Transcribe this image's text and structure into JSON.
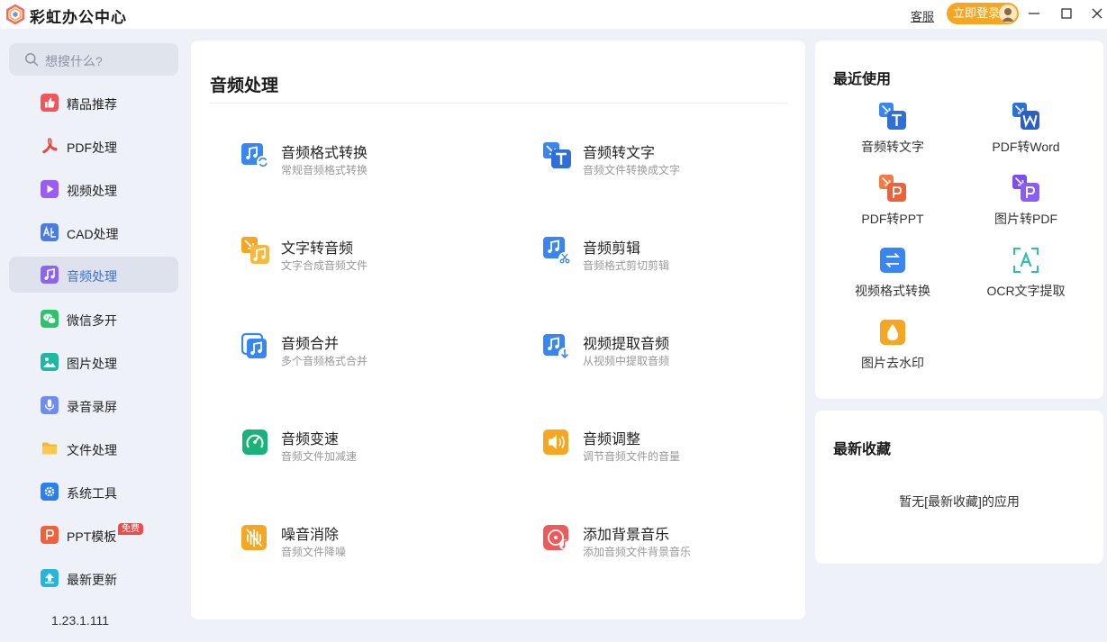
{
  "app": {
    "title": "彩虹办公中心",
    "service_label": "客服",
    "login_label": "立即登录"
  },
  "search": {
    "placeholder": "想搜什么?"
  },
  "sidebar": {
    "items": [
      {
        "label": "精品推荐",
        "icon": "thumbs-up-icon",
        "color": "#f0555a"
      },
      {
        "label": "PDF处理",
        "icon": "pdf-icon",
        "color": "#ffffff"
      },
      {
        "label": "视频处理",
        "icon": "play-icon",
        "color": "#9b5cf6"
      },
      {
        "label": "CAD处理",
        "icon": "cad-icon",
        "color": "#4a7de2"
      },
      {
        "label": "音频处理",
        "icon": "music-icon",
        "color": "#8d63f2"
      },
      {
        "label": "微信多开",
        "icon": "wechat-icon",
        "color": "#2bc46b"
      },
      {
        "label": "图片处理",
        "icon": "image-icon",
        "color": "#20b8a0"
      },
      {
        "label": "录音录屏",
        "icon": "microphone-icon",
        "color": "#6f8cf3"
      },
      {
        "label": "文件处理",
        "icon": "folder-icon",
        "color": "#f9b52c"
      },
      {
        "label": "系统工具",
        "icon": "gear-icon",
        "color": "#2c7df0"
      },
      {
        "label": "PPT模板",
        "icon": "ppt-icon",
        "color": "#f0603a",
        "badge": "免费"
      },
      {
        "label": "最新更新",
        "icon": "upload-icon",
        "color": "#27b5d8"
      }
    ],
    "version": "1.23.1.111"
  },
  "main": {
    "title": "音频处理",
    "tools": [
      {
        "name": "音频格式转换",
        "desc": "常规音频格式转换"
      },
      {
        "name": "音频转文字",
        "desc": "音频文件转换成文字"
      },
      {
        "name": "文字转音频",
        "desc": "文字合成音频文件"
      },
      {
        "name": "音频剪辑",
        "desc": "音频格式剪切剪辑"
      },
      {
        "name": "音频合并",
        "desc": "多个音频格式合并"
      },
      {
        "name": "视频提取音频",
        "desc": "从视频中提取音频"
      },
      {
        "name": "音频变速",
        "desc": "音频文件加减速"
      },
      {
        "name": "音频调整",
        "desc": "调节音频文件的音量"
      },
      {
        "name": "噪音消除",
        "desc": "音频文件降噪"
      },
      {
        "name": "添加背景音乐",
        "desc": "添加音频文件背景音乐"
      }
    ]
  },
  "recent": {
    "title": "最近使用",
    "items": [
      {
        "label": "音频转文字"
      },
      {
        "label": "PDF转Word"
      },
      {
        "label": "PDF转PPT"
      },
      {
        "label": "图片转PDF"
      },
      {
        "label": "视频格式转换"
      },
      {
        "label": "OCR文字提取"
      },
      {
        "label": "图片去水印"
      }
    ]
  },
  "favorites": {
    "title": "最新收藏",
    "empty_text": "暂无[最新收藏]的应用"
  }
}
